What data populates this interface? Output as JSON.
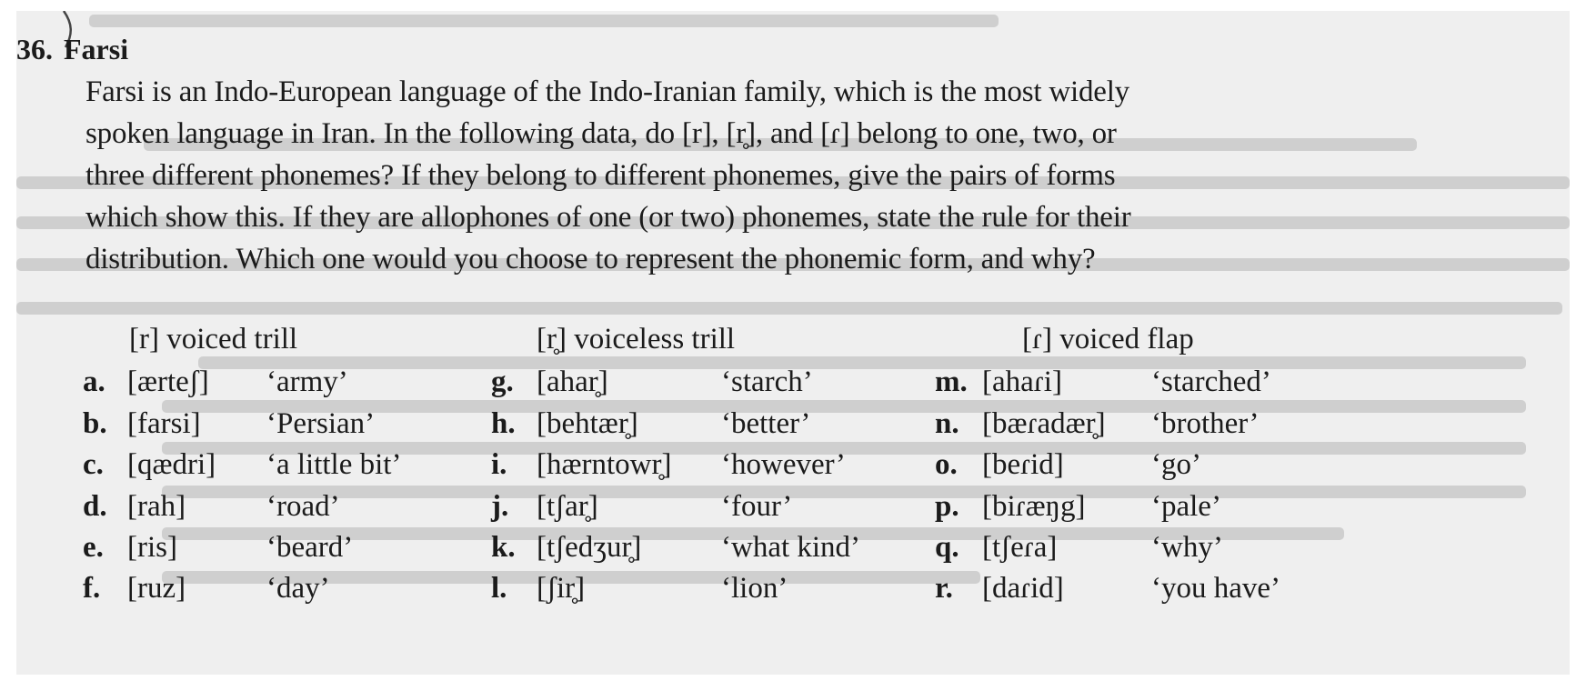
{
  "problem": {
    "number": "36.",
    "title": "Farsi",
    "intro_lines": [
      "Farsi is an Indo-European language of the Indo-Iranian family, which is the most widely",
      "spoken language in Iran. In the following data, do [r], [r̥], and [ɾ] belong to one, two, or",
      "three different phonemes? If they belong to different phonemes, give the pairs of forms",
      "which show this. If they are allophones of one (or two) phonemes, state the rule for their",
      "distribution. Which one would you choose to represent the phonemic form, and why?"
    ]
  },
  "legend": [
    {
      "symbol": "[r]",
      "desc": "voiced trill"
    },
    {
      "symbol": "[r̥]",
      "desc": "voiceless trill"
    },
    {
      "symbol": "[ɾ]",
      "desc": "voiced flap"
    }
  ],
  "columns": [
    [
      {
        "label": "a.",
        "form": "[ærteʃ]",
        "gloss": "‘army’"
      },
      {
        "label": "b.",
        "form": "[farsi]",
        "gloss": "‘Persian’"
      },
      {
        "label": "c.",
        "form": "[qædri]",
        "gloss": "‘a little bit’"
      },
      {
        "label": "d.",
        "form": "[rah]",
        "gloss": "‘road’"
      },
      {
        "label": "e.",
        "form": "[ris]",
        "gloss": "‘beard’"
      },
      {
        "label": "f.",
        "form": "[ruz]",
        "gloss": "‘day’"
      }
    ],
    [
      {
        "label": "g.",
        "form": "[ahar̥]",
        "gloss": "‘starch’"
      },
      {
        "label": "h.",
        "form": "[behtær̥]",
        "gloss": "‘better’"
      },
      {
        "label": "i.",
        "form": "[hærntowr̥]",
        "gloss": "‘however’"
      },
      {
        "label": "j.",
        "form": "[tʃar̥]",
        "gloss": "‘four’"
      },
      {
        "label": "k.",
        "form": "[tʃedʒur̥]",
        "gloss": "‘what kind’"
      },
      {
        "label": "l.",
        "form": "[ʃir̥]",
        "gloss": "‘lion’"
      }
    ],
    [
      {
        "label": "m.",
        "form": "[ahaɾi]",
        "gloss": "‘starched’"
      },
      {
        "label": "n.",
        "form": "[bæɾadær̥]",
        "gloss": "‘brother’"
      },
      {
        "label": "o.",
        "form": "[beɾid]",
        "gloss": "‘go’"
      },
      {
        "label": "p.",
        "form": "[biɾæŋg]",
        "gloss": "‘pale’"
      },
      {
        "label": "q.",
        "form": "[tʃeɾa]",
        "gloss": "‘why’"
      },
      {
        "label": "r.",
        "form": "[daɾid]",
        "gloss": "‘you have’"
      }
    ]
  ]
}
